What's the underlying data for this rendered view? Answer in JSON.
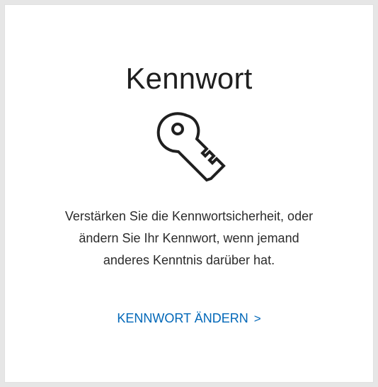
{
  "card": {
    "title": "Kennwort",
    "icon": "key-icon",
    "description_lines": [
      "Verstärken Sie die Kennwortsicherheit, oder",
      "ändern Sie Ihr Kennwort, wenn jemand",
      "anderes Kenntnis darüber hat."
    ],
    "link_label": "KENNWORT ÄNDERN",
    "link_chevron": ">",
    "link_color": "#0067b8"
  }
}
